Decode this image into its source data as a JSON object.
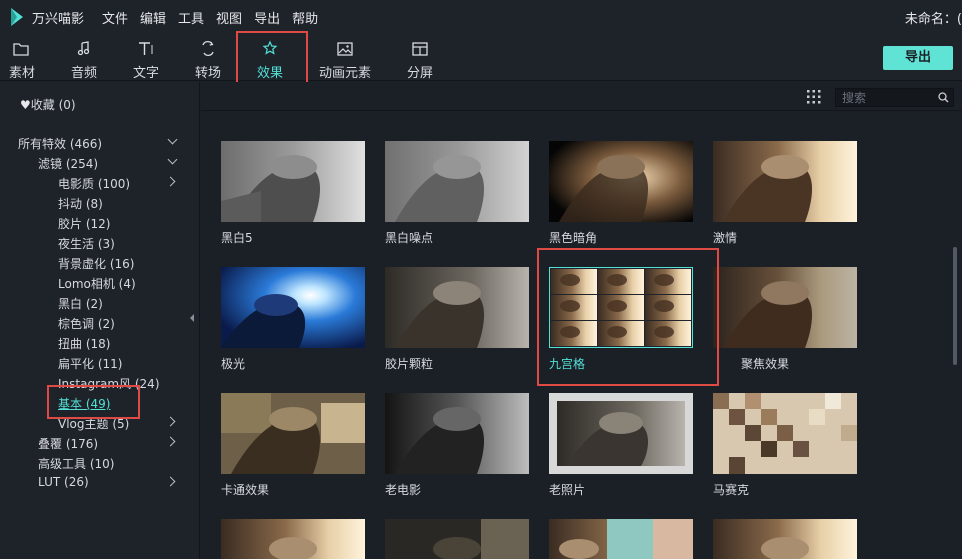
{
  "app": {
    "name": "万兴喵影",
    "doc_title": "未命名：(",
    "menu": [
      "文件",
      "编辑",
      "工具",
      "视图",
      "导出",
      "帮助"
    ]
  },
  "toolbar": {
    "tabs": [
      {
        "label": "素材",
        "icon": "folder-icon"
      },
      {
        "label": "音频",
        "icon": "music-note-icon"
      },
      {
        "label": "文字",
        "icon": "text-icon"
      },
      {
        "label": "转场",
        "icon": "transition-icon"
      },
      {
        "label": "效果",
        "icon": "effects-icon",
        "active": true
      },
      {
        "label": "动画元素",
        "icon": "image-icon"
      },
      {
        "label": "分屏",
        "icon": "split-screen-icon"
      }
    ],
    "export_label": "导出"
  },
  "sidebar": {
    "favorites": "收藏 (0)",
    "all_effects": "所有特效 (466)",
    "filters": "滤镜 (254)",
    "filter_items": [
      "电影质 (100)",
      "抖动 (8)",
      "胶片 (12)",
      "夜生活 (3)",
      "背景虚化 (16)",
      "Lomo相机 (4)",
      "黑白 (2)",
      "棕色调 (2)",
      "扭曲 (18)",
      "扁平化 (11)",
      "Instagram风 (24)",
      "基本 (49)",
      "Vlog主题 (5)"
    ],
    "overlays": "叠覆 (176)",
    "advanced_tools": "高级工具 (10)",
    "lut": "LUT (26)"
  },
  "search": {
    "placeholder": "搜索"
  },
  "effects": [
    {
      "label": "黑白5"
    },
    {
      "label": "黑白噪点"
    },
    {
      "label": "黑色暗角"
    },
    {
      "label": "激情"
    },
    {
      "label": "极光"
    },
    {
      "label": "胶片颗粒"
    },
    {
      "label": "九宫格",
      "selected": true
    },
    {
      "label": "聚焦效果"
    },
    {
      "label": "卡通效果"
    },
    {
      "label": "老电影"
    },
    {
      "label": "老照片"
    },
    {
      "label": "马赛克"
    },
    {
      "label": ""
    },
    {
      "label": ""
    },
    {
      "label": ""
    },
    {
      "label": ""
    }
  ],
  "colors": {
    "accent": "#53e0d6",
    "highlight_box": "#e04a44",
    "export_button": "#5ee3d4",
    "background": "#1b1f26",
    "panel": "#1e2229"
  }
}
